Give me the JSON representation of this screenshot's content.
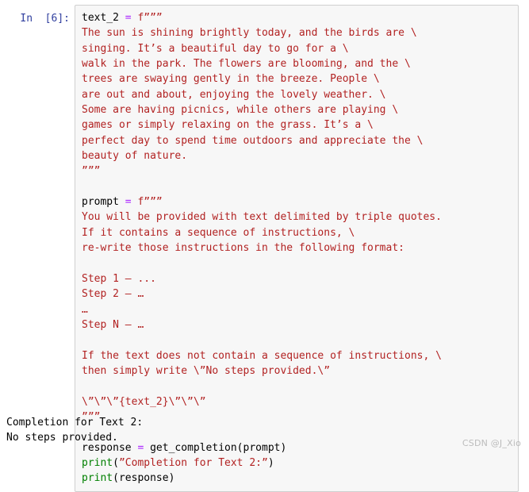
{
  "cell": {
    "prompt_label": "In  [6]:",
    "execution_count": "6",
    "code_lines": [
      {
        "segments": [
          {
            "t": "text_2 ",
            "c": "name"
          },
          {
            "t": "=",
            "c": "op"
          },
          {
            "t": " ",
            "c": "name"
          },
          {
            "t": "f”””",
            "c": "str"
          }
        ]
      },
      {
        "segments": [
          {
            "t": "The sun is shining brightly today, and the birds are \\",
            "c": "str"
          }
        ]
      },
      {
        "segments": [
          {
            "t": "singing. It’s a beautiful day to go for a \\",
            "c": "str"
          }
        ]
      },
      {
        "segments": [
          {
            "t": "walk in the park. The flowers are blooming, and the \\",
            "c": "str"
          }
        ]
      },
      {
        "segments": [
          {
            "t": "trees are swaying gently in the breeze. People \\",
            "c": "str"
          }
        ]
      },
      {
        "segments": [
          {
            "t": "are out and about, enjoying the lovely weather. \\",
            "c": "str"
          }
        ]
      },
      {
        "segments": [
          {
            "t": "Some are having picnics, while others are playing \\",
            "c": "str"
          }
        ]
      },
      {
        "segments": [
          {
            "t": "games or simply relaxing on the grass. It’s a \\",
            "c": "str"
          }
        ]
      },
      {
        "segments": [
          {
            "t": "perfect day to spend time outdoors and appreciate the \\",
            "c": "str"
          }
        ]
      },
      {
        "segments": [
          {
            "t": "beauty of nature.",
            "c": "str"
          }
        ]
      },
      {
        "segments": [
          {
            "t": "”””",
            "c": "str"
          }
        ]
      },
      {
        "segments": [
          {
            "t": "",
            "c": "name"
          }
        ]
      },
      {
        "segments": [
          {
            "t": "prompt ",
            "c": "name"
          },
          {
            "t": "=",
            "c": "op"
          },
          {
            "t": " ",
            "c": "name"
          },
          {
            "t": "f”””",
            "c": "str"
          }
        ]
      },
      {
        "segments": [
          {
            "t": "You will be provided with text delimited by triple quotes.",
            "c": "str"
          }
        ]
      },
      {
        "segments": [
          {
            "t": "If it contains a sequence of instructions, \\",
            "c": "str"
          }
        ]
      },
      {
        "segments": [
          {
            "t": "re-write those instructions in the following format:",
            "c": "str"
          }
        ]
      },
      {
        "segments": [
          {
            "t": "",
            "c": "name"
          }
        ]
      },
      {
        "segments": [
          {
            "t": "Step 1 – ...",
            "c": "str"
          }
        ]
      },
      {
        "segments": [
          {
            "t": "Step 2 – …",
            "c": "str"
          }
        ]
      },
      {
        "segments": [
          {
            "t": "…",
            "c": "str"
          }
        ]
      },
      {
        "segments": [
          {
            "t": "Step N – …",
            "c": "str"
          }
        ]
      },
      {
        "segments": [
          {
            "t": "",
            "c": "name"
          }
        ]
      },
      {
        "segments": [
          {
            "t": "If the text does not contain a sequence of instructions, \\",
            "c": "str"
          }
        ]
      },
      {
        "segments": [
          {
            "t": "then simply write \\”No steps provided.\\”",
            "c": "str"
          }
        ]
      },
      {
        "segments": [
          {
            "t": "",
            "c": "name"
          }
        ]
      },
      {
        "segments": [
          {
            "t": "\\”\\”\\”{text_2}\\”\\”\\”",
            "c": "str"
          }
        ]
      },
      {
        "segments": [
          {
            "t": "”””",
            "c": "str"
          }
        ]
      },
      {
        "segments": [
          {
            "t": "",
            "c": "name"
          }
        ]
      },
      {
        "segments": [
          {
            "t": "response ",
            "c": "name"
          },
          {
            "t": "=",
            "c": "op"
          },
          {
            "t": " get_completion(prompt)",
            "c": "name"
          }
        ]
      },
      {
        "segments": [
          {
            "t": "print",
            "c": "builtin"
          },
          {
            "t": "(",
            "c": "name"
          },
          {
            "t": "”Completion for Text 2:”",
            "c": "str"
          },
          {
            "t": ")",
            "c": "name"
          }
        ]
      },
      {
        "segments": [
          {
            "t": "print",
            "c": "builtin"
          },
          {
            "t": "(response)",
            "c": "name"
          }
        ]
      }
    ]
  },
  "output": {
    "lines": [
      "Completion for Text 2:",
      "No steps provided."
    ]
  },
  "watermark": {
    "text": "CSDN @J_Xio"
  },
  "colors": {
    "string": "#b22222",
    "operator": "#aa22ff",
    "builtin": "#008000",
    "prompt": "#303f9f",
    "cell_background": "#f7f7f7",
    "cell_border": "#cfcfcf",
    "watermark": "#bcbcbc"
  }
}
